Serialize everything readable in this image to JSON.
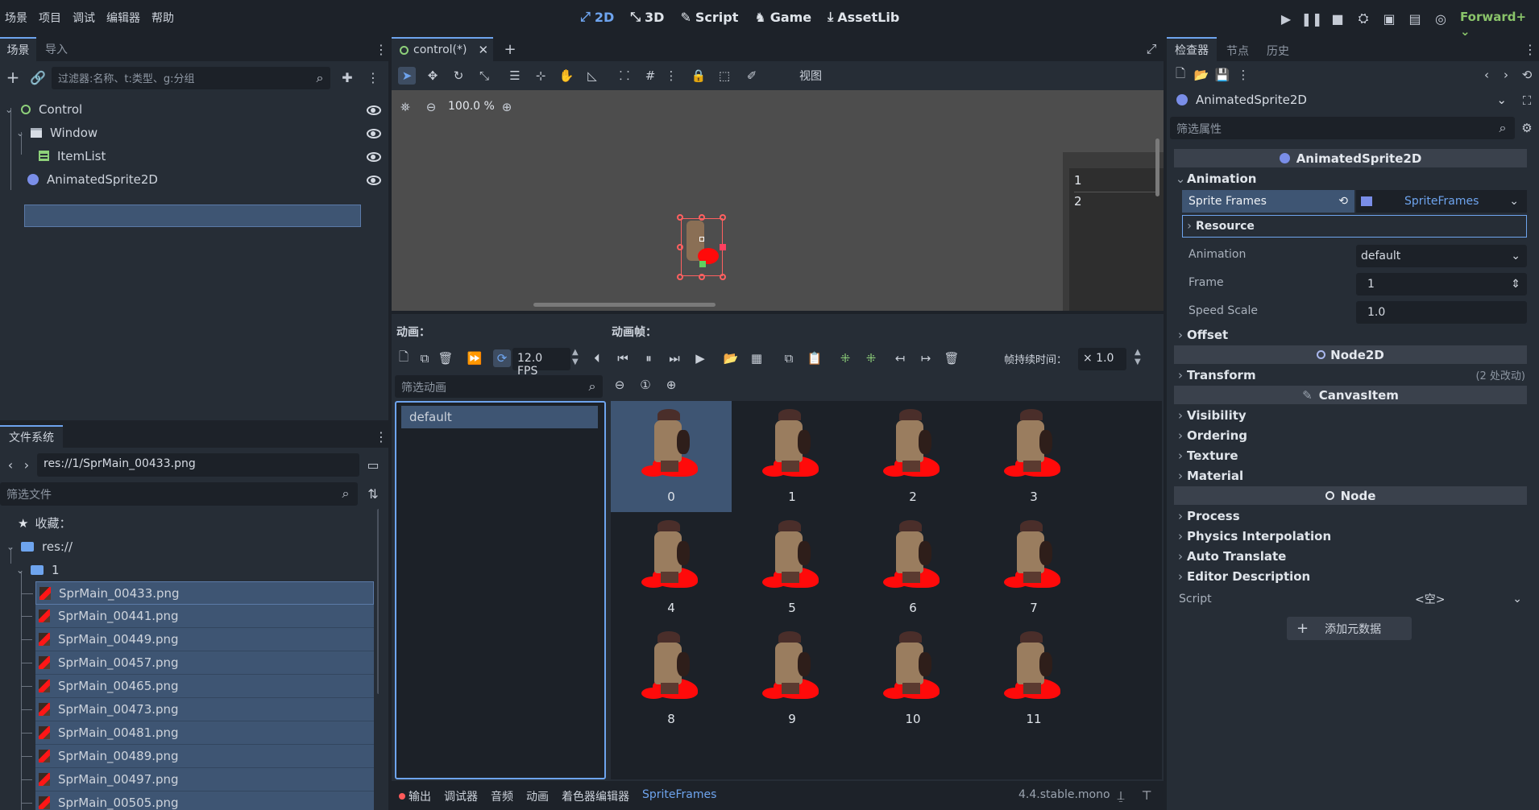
{
  "menu": [
    "场景",
    "项目",
    "调试",
    "编辑器",
    "帮助"
  ],
  "workspaces": [
    {
      "icon": "2d-icon",
      "glyph": "⤢",
      "label": "2D",
      "active": true
    },
    {
      "icon": "3d-icon",
      "glyph": "⤡",
      "label": "3D"
    },
    {
      "icon": "script-icon",
      "glyph": "✎",
      "label": "Script"
    },
    {
      "icon": "game-icon",
      "glyph": "♞",
      "label": "Game"
    },
    {
      "icon": "assetlib-icon",
      "glyph": "⤓",
      "label": "AssetLib"
    }
  ],
  "renderer": "Forward+",
  "scene_panel": {
    "tabs": [
      "场景",
      "导入"
    ],
    "filter_placeholder": "过滤器:名称、t:类型、g:分组",
    "nodes": [
      {
        "label": "Control",
        "icon": "control-icon"
      },
      {
        "label": "Window",
        "icon": "window-icon"
      },
      {
        "label": "ItemList",
        "icon": "itemlist-icon"
      },
      {
        "label": "AnimatedSprite2D",
        "icon": "animatedsprite-icon"
      }
    ]
  },
  "filesystem": {
    "tab": "文件系统",
    "path": "res://1/SprMain_00433.png",
    "filter_placeholder": "筛选文件",
    "favorites": "收藏：",
    "root": "res://",
    "folder": "1",
    "files": [
      "SprMain_00433.png",
      "SprMain_00441.png",
      "SprMain_00449.png",
      "SprMain_00457.png",
      "SprMain_00465.png",
      "SprMain_00473.png",
      "SprMain_00481.png",
      "SprMain_00489.png",
      "SprMain_00497.png",
      "SprMain_00505.png"
    ]
  },
  "editor": {
    "scene_tab": "control(*)",
    "view_menu": "视图",
    "zoom": "100.0 %",
    "item_list": [
      "1",
      "2"
    ]
  },
  "spriteframes": {
    "animations_label": "动画：",
    "frames_label": "动画帧：",
    "fps": "12.0 FPS",
    "duration_label": "帧持续时间：",
    "duration_value": "× 1.0",
    "anim_filter_placeholder": "筛选动画",
    "animations": [
      "default"
    ],
    "frames": [
      "0",
      "1",
      "2",
      "3",
      "4",
      "5",
      "6",
      "7",
      "8",
      "9",
      "10",
      "11"
    ]
  },
  "bottom_bar": {
    "tabs": [
      "输出",
      "调试器",
      "音频",
      "动画",
      "着色器编辑器",
      "SpriteFrames"
    ],
    "active_tab": "SpriteFrames",
    "version": "4.4.stable.mono"
  },
  "inspector": {
    "tabs": [
      "检查器",
      "节点",
      "历史"
    ],
    "object": "AnimatedSprite2D",
    "filter_placeholder": "筛选属性",
    "class_header": "AnimatedSprite2D",
    "animation_section": "Animation",
    "sprite_frames_label": "Sprite Frames",
    "sprite_frames_value": "SpriteFrames",
    "resource_label": "Resource",
    "props": [
      {
        "label": "Animation",
        "value": "default"
      },
      {
        "label": "Frame",
        "value": "1"
      },
      {
        "label": "Speed Scale",
        "value": "1.0"
      }
    ],
    "offset": "Offset",
    "node2d_header": "Node2D",
    "transform": "Transform",
    "transform_note": "(2 处改动)",
    "canvasitem_header": "CanvasItem",
    "canvasitem_sections": [
      "Visibility",
      "Ordering",
      "Texture",
      "Material"
    ],
    "node_header": "Node",
    "node_sections": [
      "Process",
      "Physics Interpolation",
      "Auto Translate",
      "Editor Description"
    ],
    "script_label": "Script",
    "script_value": "<空>",
    "add_metadata": "添加元数据"
  },
  "colors": {
    "accent": "#6ea4ee",
    "selection": "#3e5573",
    "sprite_blood": "#ff0a0a"
  }
}
